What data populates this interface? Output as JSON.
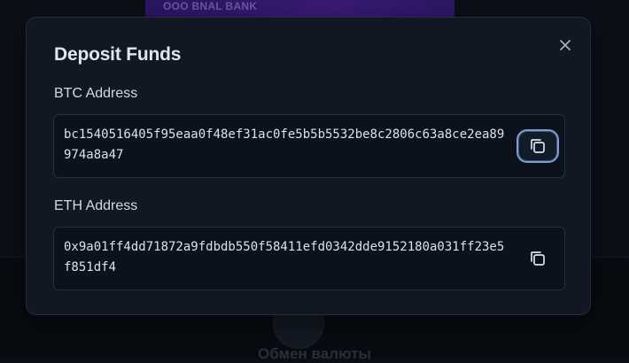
{
  "background": {
    "card_text": "OOO BNAL BANK",
    "caption": "Обмен валюты"
  },
  "modal": {
    "title": "Deposit Funds",
    "close_icon": "close-icon",
    "fields": [
      {
        "label": "BTC Address",
        "address": "bc1540516405f95eaa0f48ef31ac0fe5b5b5532be8c2806c63a8ce2ea89974a8a47",
        "copy_icon": "copy-icon"
      },
      {
        "label": "ETH Address",
        "address": "0x9a01ff4dd71872a9fdbdb550f58411efd0342dde9152180a031ff23e5f851df4",
        "copy_icon": "copy-icon"
      }
    ]
  },
  "colors": {
    "modal_bg": "#111824",
    "focus_ring": "#7e9ccf",
    "text": "#dbe2ec"
  }
}
